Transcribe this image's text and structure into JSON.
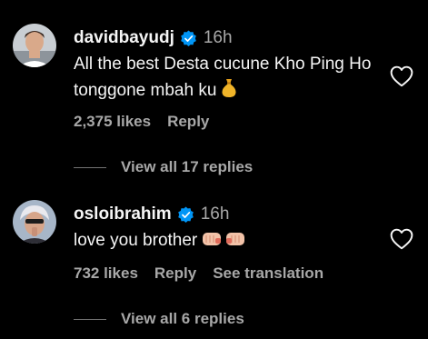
{
  "comments": [
    {
      "username": "davidbayudj",
      "time": "16h",
      "text": "All the best Desta cucune Kho Ping Ho tonggone mbah ku",
      "emoji": "money-bag-icon",
      "likes": "2,375 likes",
      "reply": "Reply",
      "view_replies": "View all 17 replies"
    },
    {
      "username": "osloibrahim",
      "time": "16h",
      "text": "love you brother",
      "emoji": "fist-bump-icons",
      "likes": "732 likes",
      "reply": "Reply",
      "translate": "See translation",
      "view_replies": "View all 6 replies"
    }
  ],
  "colors": {
    "background": "#000000",
    "primary_text": "#f5f5f5",
    "secondary_text": "#a8a8a8",
    "verified": "#0095f6"
  }
}
